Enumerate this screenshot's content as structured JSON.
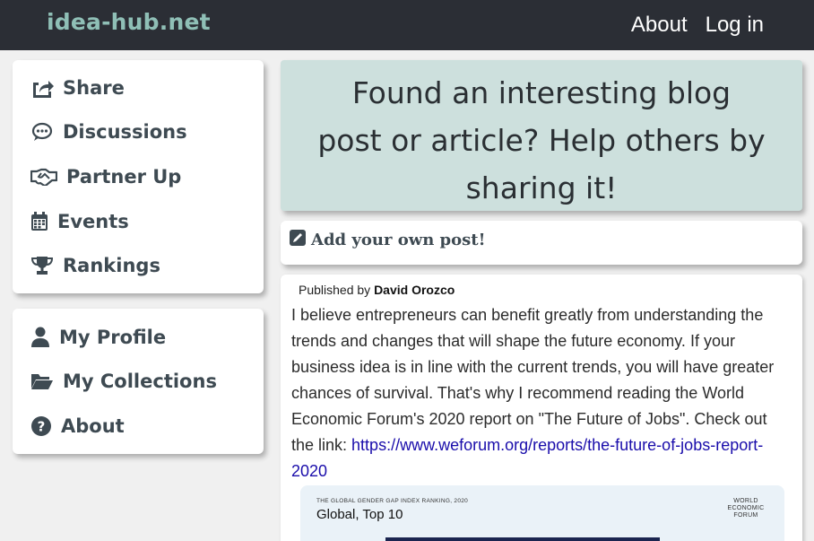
{
  "header": {
    "brand": "idea-hub.net",
    "nav": [
      {
        "label": "About"
      },
      {
        "label": "Log in"
      }
    ]
  },
  "sidebar_main": {
    "items": [
      {
        "label": "Share",
        "icon": "share-icon"
      },
      {
        "label": "Discussions",
        "icon": "comment-icon"
      },
      {
        "label": "Partner Up",
        "icon": "handshake-icon"
      },
      {
        "label": "Events",
        "icon": "calendar-icon"
      },
      {
        "label": "Rankings",
        "icon": "trophy-icon"
      }
    ]
  },
  "sidebar_user": {
    "items": [
      {
        "label": "My Profile",
        "icon": "user-icon"
      },
      {
        "label": "My Collections",
        "icon": "folder-open-icon"
      },
      {
        "label": "About",
        "icon": "question-circle-icon"
      }
    ]
  },
  "hero": {
    "text": "Found an interesting blog post or article? Help others by sharing it!"
  },
  "add_post": {
    "label": "Add your own post!",
    "icon": "edit-icon"
  },
  "post": {
    "published_by_prefix": "Published by",
    "author": "David Orozco",
    "body": "I believe entrepreneurs can benefit greatly from understanding the trends and changes that will shape the future economy. If your business idea is in line with the current trends, you will have greater chances of survival. That's why I recommend reading the World Economic Forum's 2020 report on \"The Future of Jobs\". Check out the link: ",
    "link_text": "https://www.weforum.org/reports/the-future-of-jobs-report-2020",
    "preview": {
      "kicker": "THE GLOBAL GENDER GAP INDEX RANKING, 2020",
      "title": "Global, Top 10",
      "logo": "WORLD ECONOMIC FORUM"
    }
  },
  "colors": {
    "topbar": "#2b2e35",
    "brand": "#8fbfb6",
    "hero_bg": "#cde0dd",
    "text": "#3e4a52",
    "link": "#1a0dab"
  }
}
